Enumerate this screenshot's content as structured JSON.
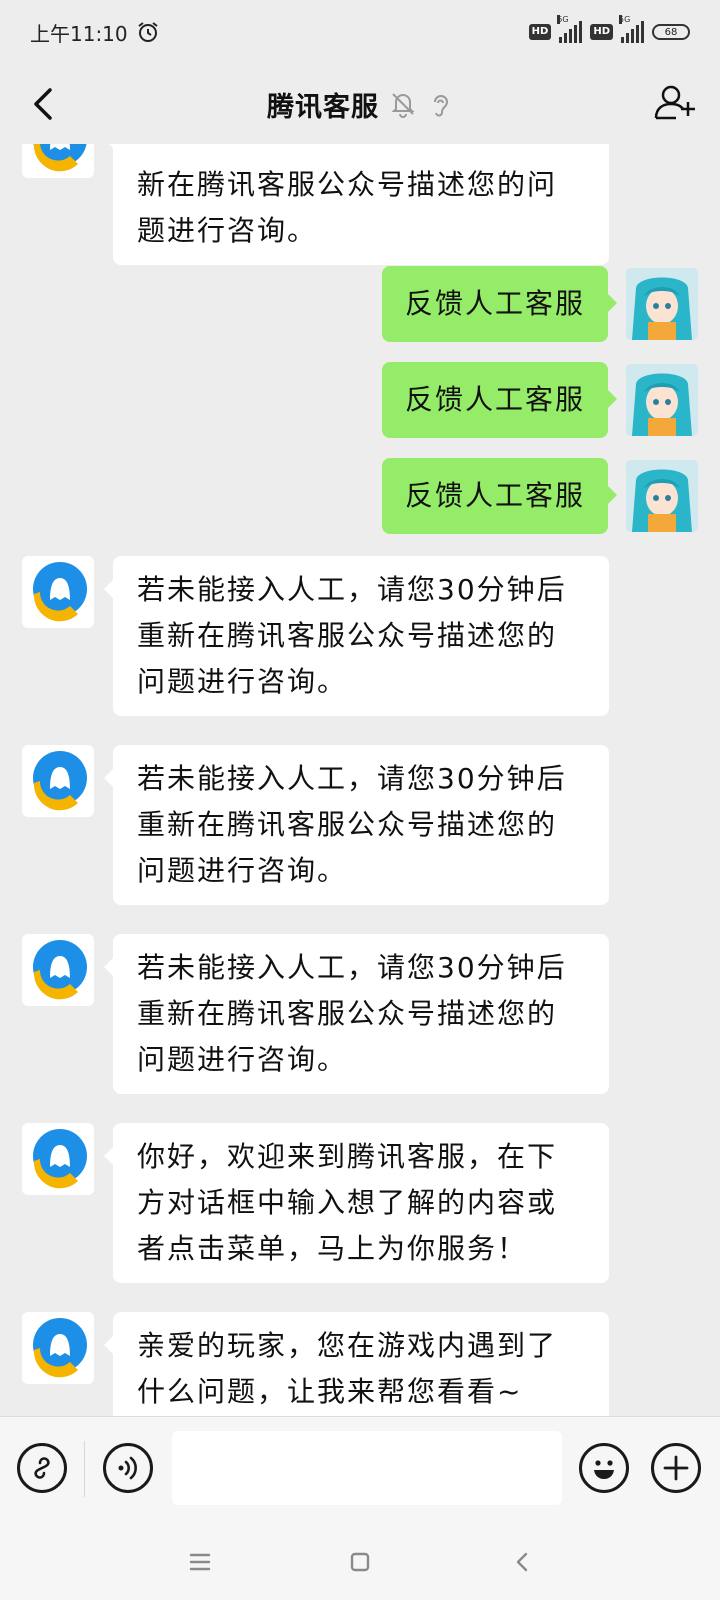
{
  "status_bar": {
    "time": "上午11:10",
    "hd_label": "HD",
    "network_label": "5G",
    "battery": "68"
  },
  "header": {
    "title": "腾讯客服"
  },
  "messages": [
    {
      "side": "in",
      "text": "新在腾讯客服公众号描述您的问题进行咨询。"
    },
    {
      "side": "out",
      "text": "反馈人工客服"
    },
    {
      "side": "out",
      "text": "反馈人工客服"
    },
    {
      "side": "out",
      "text": "反馈人工客服"
    },
    {
      "side": "in",
      "text": "若未能接入人工，请您30分钟后重新在腾讯客服公众号描述您的问题进行咨询。"
    },
    {
      "side": "in",
      "text": "若未能接入人工，请您30分钟后重新在腾讯客服公众号描述您的问题进行咨询。"
    },
    {
      "side": "in",
      "text": "若未能接入人工，请您30分钟后重新在腾讯客服公众号描述您的问题进行咨询。"
    },
    {
      "side": "in",
      "text": "你好，欢迎来到腾讯客服，在下方对话框中输入想了解的内容或者点击菜单，马上为你服务！"
    },
    {
      "side": "in",
      "text": "亲爱的玩家，您在游戏内遇到了什么问题，让我来帮您看看~"
    }
  ],
  "input_bar": {
    "placeholder": ""
  },
  "icons": {
    "back": "chevron-left-icon",
    "mute": "bell-off-icon",
    "earpiece": "ear-icon",
    "add_member": "add-user-icon",
    "menu_link": "link-icon",
    "voice": "voice-icon",
    "emoji": "emoji-icon",
    "more": "plus-icon",
    "nav_menu": "menu-icon",
    "nav_home": "square-icon",
    "nav_back": "back-icon"
  },
  "colors": {
    "background": "#ededed",
    "outgoing_bubble": "#95ec69",
    "incoming_bubble": "#ffffff",
    "bot_avatar_blue": "#1e8fe6",
    "bot_avatar_yellow": "#f5b400"
  }
}
